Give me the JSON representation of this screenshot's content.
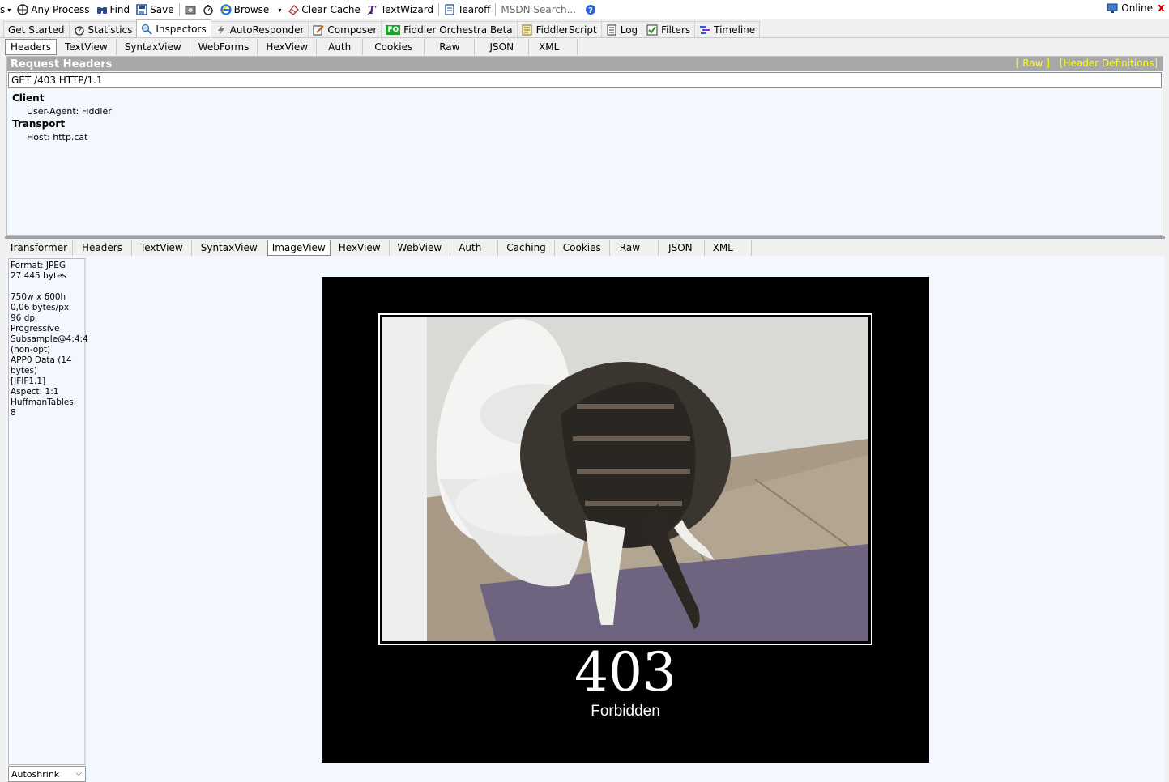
{
  "toolbar": {
    "edge_text": "s",
    "any_process": "Any Process",
    "find": "Find",
    "save": "Save",
    "browse": "Browse",
    "clear_cache": "Clear Cache",
    "text_wizard": "TextWizard",
    "tearoff": "Tearoff",
    "msdn_placeholder": "MSDN Search...",
    "online": "Online",
    "close": "x"
  },
  "main_tabs": [
    {
      "label": "Get Started"
    },
    {
      "label": "Statistics"
    },
    {
      "label": "Inspectors",
      "active": true
    },
    {
      "label": "AutoResponder"
    },
    {
      "label": "Composer"
    },
    {
      "label": "Fiddler Orchestra Beta",
      "badge": "FO"
    },
    {
      "label": "FiddlerScript"
    },
    {
      "label": "Log"
    },
    {
      "label": "Filters"
    },
    {
      "label": "Timeline"
    }
  ],
  "request_tabs": [
    "Headers",
    "TextView",
    "SyntaxView",
    "WebForms",
    "HexView",
    "Auth",
    "Cookies",
    "Raw",
    "JSON",
    "XML"
  ],
  "request_active_tab": "Headers",
  "request": {
    "title": "Request Headers",
    "raw_link": "[ Raw ]",
    "defs_link": "[Header Definitions]",
    "request_line": "GET /403 HTTP/1.1",
    "groups": [
      {
        "name": "Client",
        "headers": [
          "User-Agent: Fiddler"
        ]
      },
      {
        "name": "Transport",
        "headers": [
          "Host: http.cat"
        ]
      }
    ]
  },
  "response_tabs": [
    "Transformer",
    "Headers",
    "TextView",
    "SyntaxView",
    "ImageView",
    "HexView",
    "WebView",
    "Auth",
    "Caching",
    "Cookies",
    "Raw",
    "JSON",
    "XML"
  ],
  "response_active_tab": "ImageView",
  "image_info": [
    "Format: JPEG",
    "27 445 bytes",
    "",
    "750w x 600h",
    "0,06 bytes/px",
    "96 dpi",
    "Progressive",
    "Subsample@4:4:4",
    "(non-opt)",
    "APP0 Data (14",
    "bytes)",
    "[JFIF1.1]",
    "Aspect: 1:1",
    "HuffmanTables: 8"
  ],
  "autoshrink": "Autoshrink",
  "image": {
    "code": "403",
    "caption": "Forbidden"
  }
}
